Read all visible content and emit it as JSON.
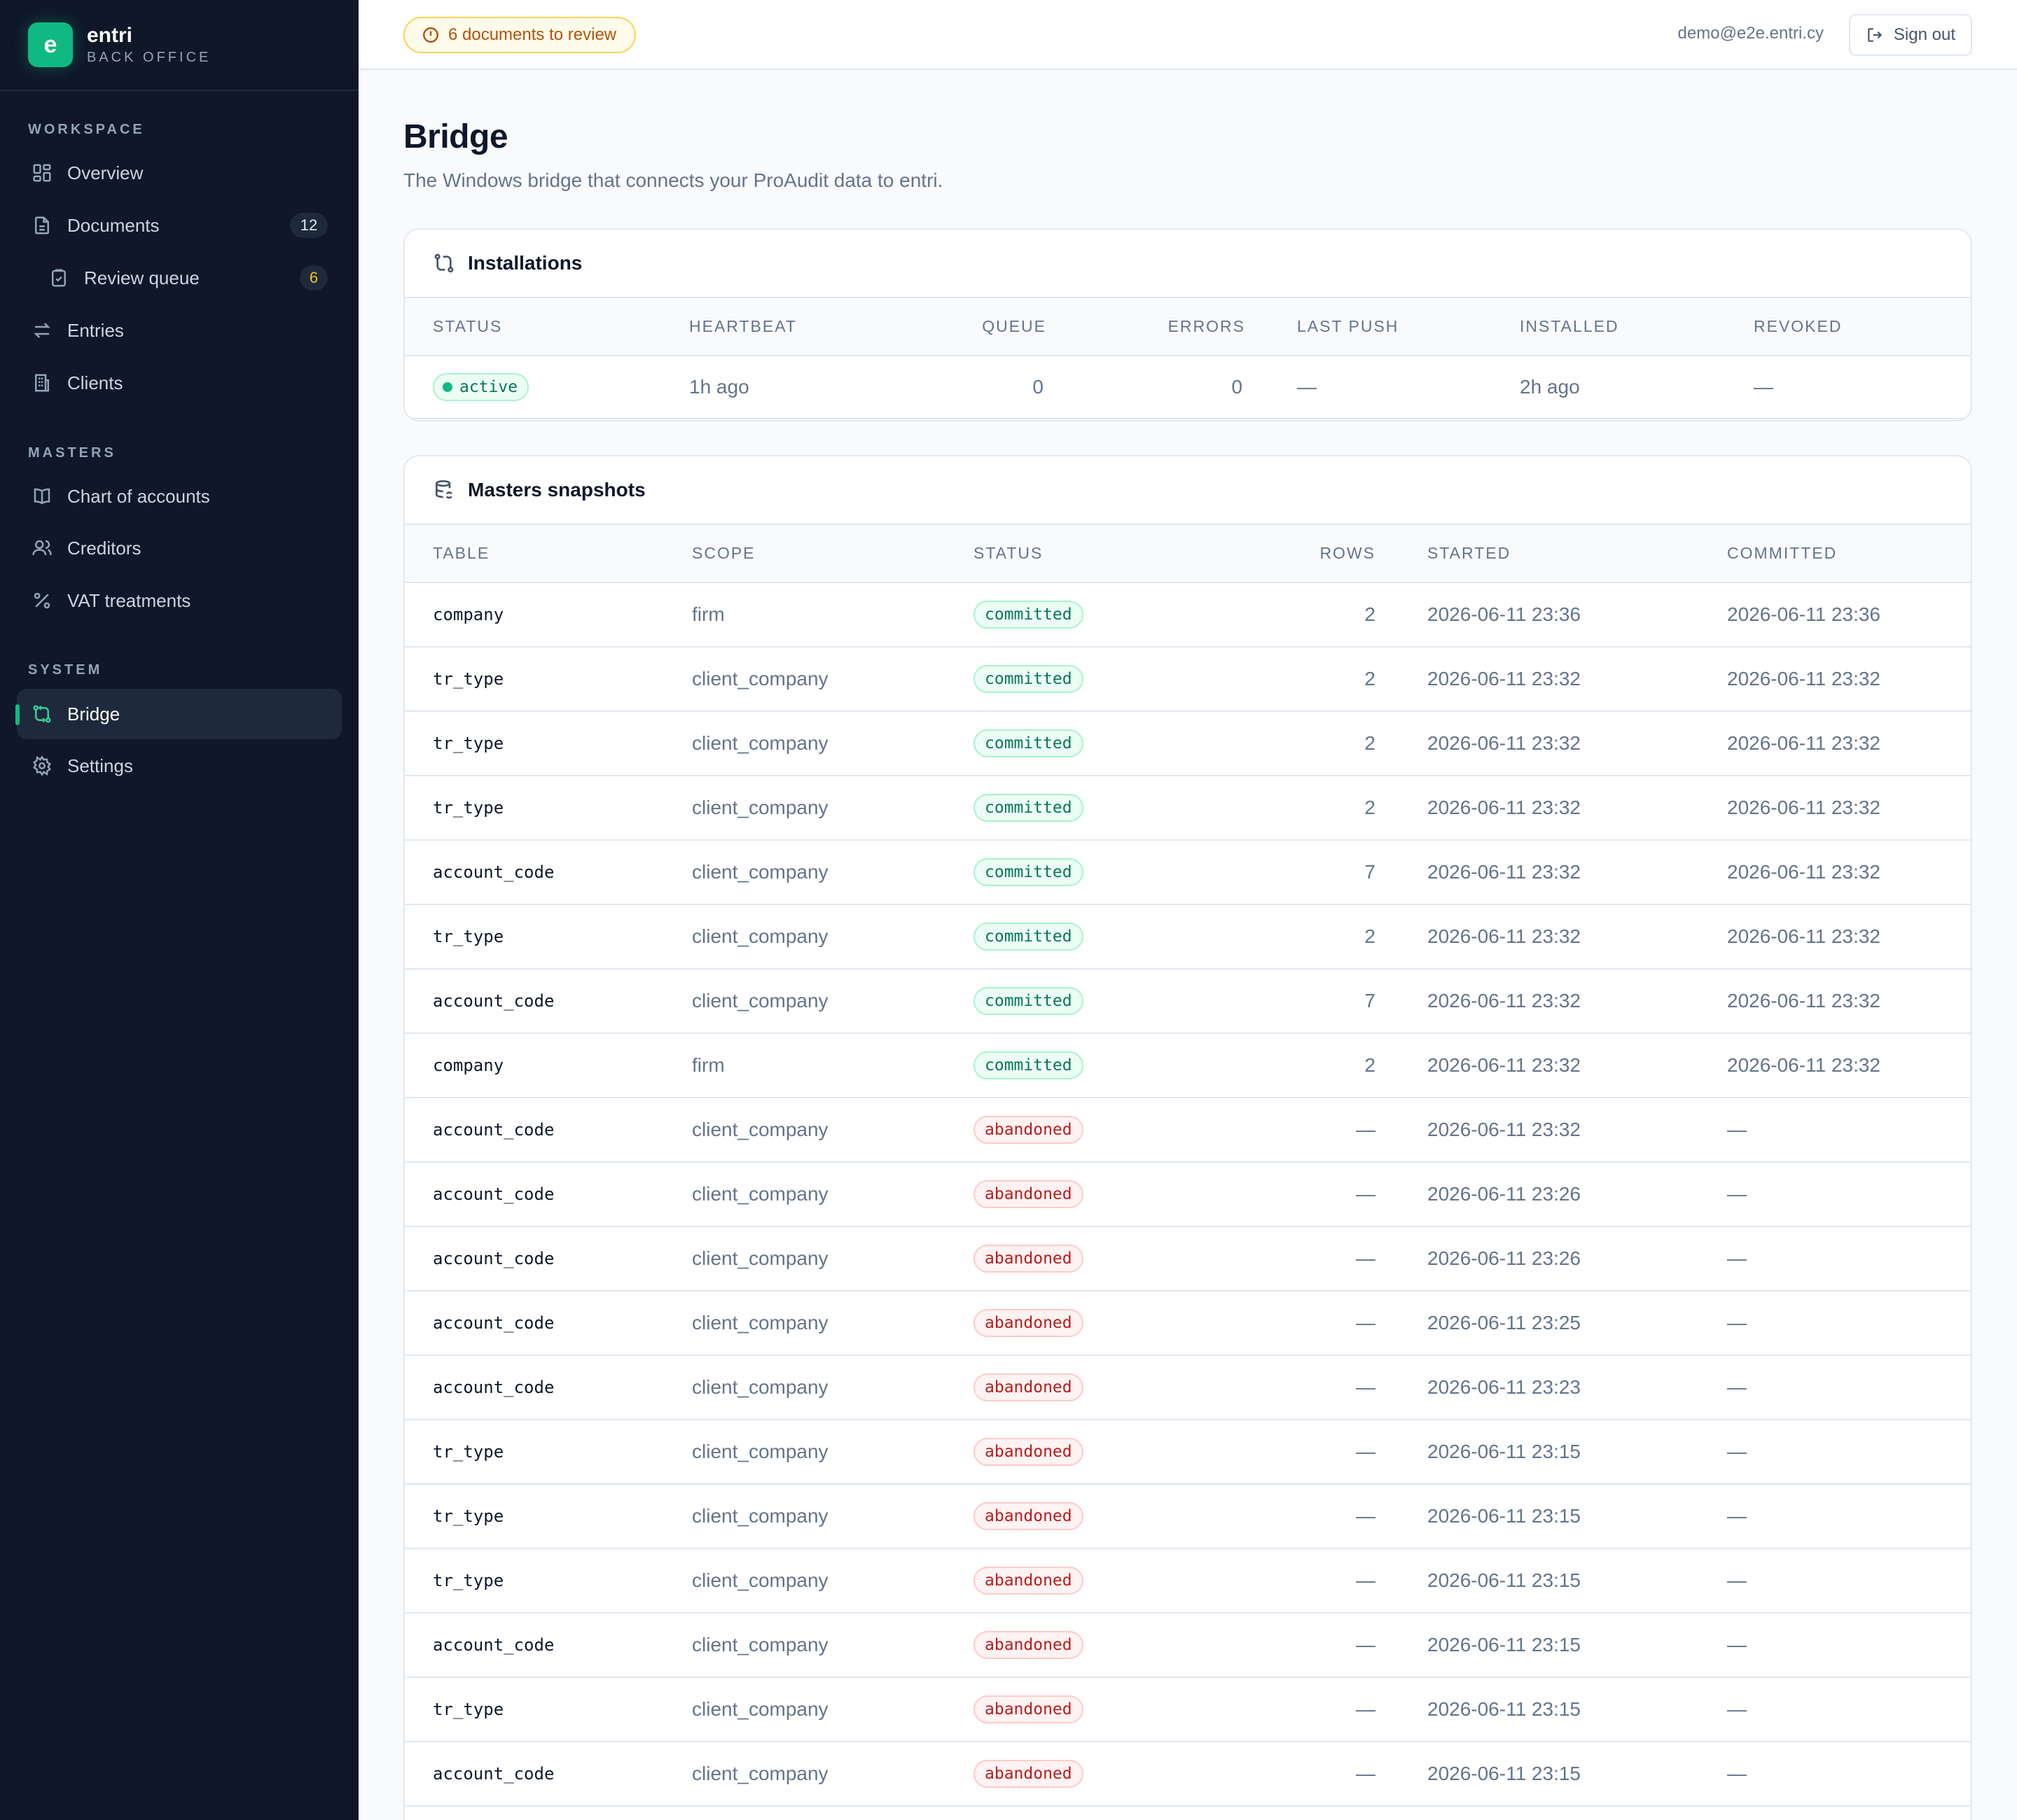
{
  "brand": {
    "logo_letter": "e",
    "name": "entri",
    "subtitle": "BACK OFFICE",
    "accent_color": "#10b981"
  },
  "sidebar": {
    "sections": [
      {
        "label": "WORKSPACE"
      },
      {
        "label": "MASTERS"
      },
      {
        "label": "SYSTEM"
      }
    ],
    "items": [
      {
        "label": "Overview",
        "icon": "grid-icon"
      },
      {
        "label": "Documents",
        "icon": "document-icon",
        "count": "12"
      },
      {
        "label": "Review queue",
        "icon": "clipboard-check-icon",
        "count": "6"
      },
      {
        "label": "Entries",
        "icon": "arrows-swap-icon"
      },
      {
        "label": "Clients",
        "icon": "building-icon"
      },
      {
        "label": "Chart of accounts",
        "icon": "book-icon"
      },
      {
        "label": "Creditors",
        "icon": "users-icon"
      },
      {
        "label": "VAT treatments",
        "icon": "percent-icon"
      },
      {
        "label": "Bridge",
        "icon": "bridge-icon",
        "active": true
      },
      {
        "label": "Settings",
        "icon": "gear-icon"
      }
    ]
  },
  "topbar": {
    "review_alert": "6 documents to review",
    "user_email": "demo@e2e.entri.cy",
    "signout_label": "Sign out"
  },
  "page": {
    "title": "Bridge",
    "subtitle": "The Windows bridge that connects your ProAudit data to entri."
  },
  "installations": {
    "title": "Installations",
    "columns": [
      "STATUS",
      "HEARTBEAT",
      "QUEUE",
      "ERRORS",
      "LAST PUSH",
      "INSTALLED",
      "REVOKED"
    ],
    "rows": [
      {
        "status": "active",
        "heartbeat": "1h ago",
        "queue": "0",
        "errors": "0",
        "last_push": "—",
        "installed": "2h ago",
        "revoked": "—"
      }
    ]
  },
  "snapshots": {
    "title": "Masters snapshots",
    "columns": [
      "TABLE",
      "SCOPE",
      "STATUS",
      "ROWS",
      "STARTED",
      "COMMITTED"
    ],
    "rows": [
      {
        "table": "company",
        "scope": "firm",
        "status": "committed",
        "rows": "2",
        "started": "2026-06-11 23:36",
        "committed": "2026-06-11 23:36"
      },
      {
        "table": "tr_type",
        "scope": "client_company",
        "status": "committed",
        "rows": "2",
        "started": "2026-06-11 23:32",
        "committed": "2026-06-11 23:32"
      },
      {
        "table": "tr_type",
        "scope": "client_company",
        "status": "committed",
        "rows": "2",
        "started": "2026-06-11 23:32",
        "committed": "2026-06-11 23:32"
      },
      {
        "table": "tr_type",
        "scope": "client_company",
        "status": "committed",
        "rows": "2",
        "started": "2026-06-11 23:32",
        "committed": "2026-06-11 23:32"
      },
      {
        "table": "account_code",
        "scope": "client_company",
        "status": "committed",
        "rows": "7",
        "started": "2026-06-11 23:32",
        "committed": "2026-06-11 23:32"
      },
      {
        "table": "tr_type",
        "scope": "client_company",
        "status": "committed",
        "rows": "2",
        "started": "2026-06-11 23:32",
        "committed": "2026-06-11 23:32"
      },
      {
        "table": "account_code",
        "scope": "client_company",
        "status": "committed",
        "rows": "7",
        "started": "2026-06-11 23:32",
        "committed": "2026-06-11 23:32"
      },
      {
        "table": "company",
        "scope": "firm",
        "status": "committed",
        "rows": "2",
        "started": "2026-06-11 23:32",
        "committed": "2026-06-11 23:32"
      },
      {
        "table": "account_code",
        "scope": "client_company",
        "status": "abandoned",
        "rows": "—",
        "started": "2026-06-11 23:32",
        "committed": "—"
      },
      {
        "table": "account_code",
        "scope": "client_company",
        "status": "abandoned",
        "rows": "—",
        "started": "2026-06-11 23:26",
        "committed": "—"
      },
      {
        "table": "account_code",
        "scope": "client_company",
        "status": "abandoned",
        "rows": "—",
        "started": "2026-06-11 23:26",
        "committed": "—"
      },
      {
        "table": "account_code",
        "scope": "client_company",
        "status": "abandoned",
        "rows": "—",
        "started": "2026-06-11 23:25",
        "committed": "—"
      },
      {
        "table": "account_code",
        "scope": "client_company",
        "status": "abandoned",
        "rows": "—",
        "started": "2026-06-11 23:23",
        "committed": "—"
      },
      {
        "table": "tr_type",
        "scope": "client_company",
        "status": "abandoned",
        "rows": "—",
        "started": "2026-06-11 23:15",
        "committed": "—"
      },
      {
        "table": "tr_type",
        "scope": "client_company",
        "status": "abandoned",
        "rows": "—",
        "started": "2026-06-11 23:15",
        "committed": "—"
      },
      {
        "table": "tr_type",
        "scope": "client_company",
        "status": "abandoned",
        "rows": "—",
        "started": "2026-06-11 23:15",
        "committed": "—"
      },
      {
        "table": "account_code",
        "scope": "client_company",
        "status": "abandoned",
        "rows": "—",
        "started": "2026-06-11 23:15",
        "committed": "—"
      },
      {
        "table": "tr_type",
        "scope": "client_company",
        "status": "abandoned",
        "rows": "—",
        "started": "2026-06-11 23:15",
        "committed": "—"
      },
      {
        "table": "account_code",
        "scope": "client_company",
        "status": "abandoned",
        "rows": "—",
        "started": "2026-06-11 23:15",
        "committed": "—"
      }
    ]
  }
}
